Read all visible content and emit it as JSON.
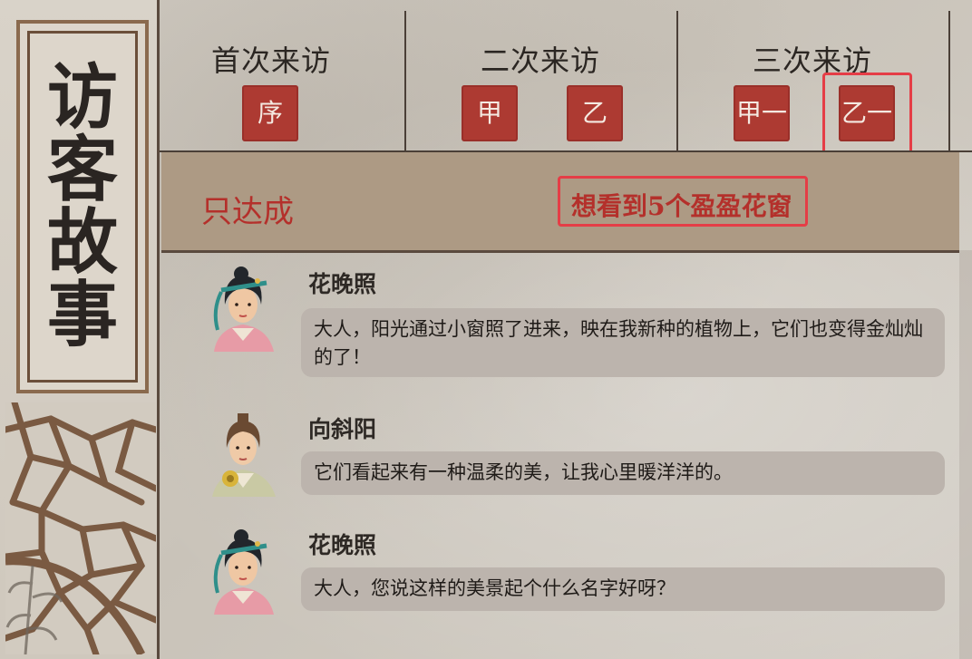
{
  "panel": {
    "title_chars": [
      "访",
      "客",
      "故",
      "事"
    ]
  },
  "visits": [
    {
      "title": "首次来访",
      "stamps": [
        "序"
      ]
    },
    {
      "title": "二次来访",
      "stamps": [
        "甲",
        "乙"
      ]
    },
    {
      "title": "三次来访",
      "stamps": [
        "甲一",
        "乙一"
      ]
    }
  ],
  "condition": {
    "label": "只达成",
    "requirement": "想看到5个盈盈花窗"
  },
  "dialogue": [
    {
      "speaker": "花晚照",
      "avatar": "hua-wanzhao-portrait",
      "text": "大人，阳光通过小窗照了进来，映在我新种的植物上，它们也变得金灿灿的了！"
    },
    {
      "speaker": "向斜阳",
      "avatar": "xiang-xieyang-portrait",
      "text": "它们看起来有一种温柔的美，让我心里暖洋洋的。"
    },
    {
      "speaker": "花晚照",
      "avatar": "hua-wanzhao-portrait",
      "text": "大人，您说这样的美景起个什么名字好呀？"
    }
  ],
  "colors": {
    "stamp": "#ad3a32",
    "highlight": "#e53d46",
    "condition_text": "#b4302b",
    "condition_bar": "#ad9a84"
  }
}
